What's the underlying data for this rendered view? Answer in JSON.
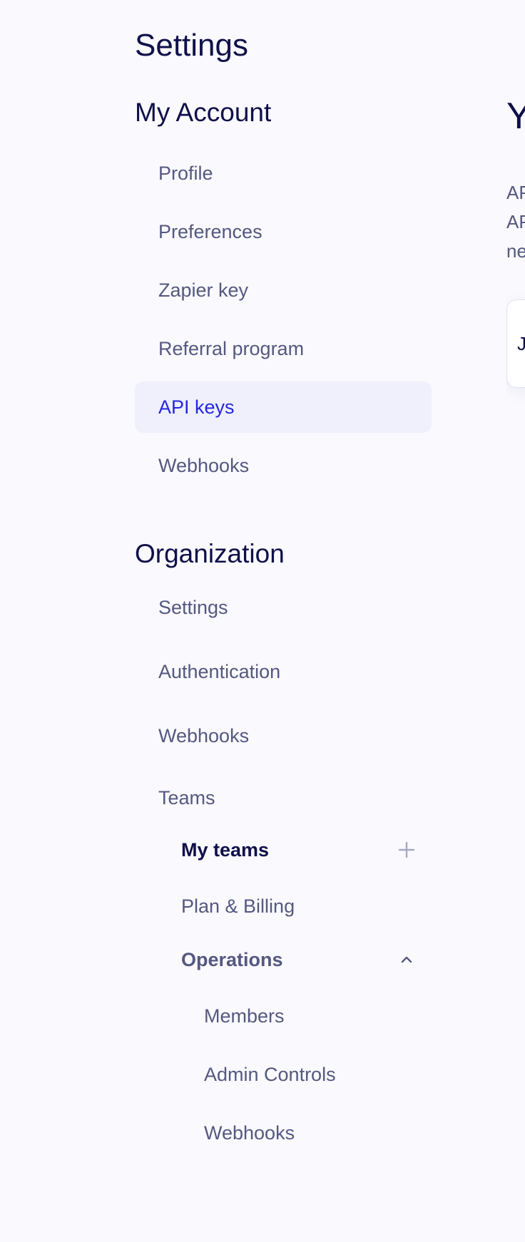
{
  "sidebar": {
    "title": "Settings",
    "my_account": {
      "heading": "My Account",
      "items": [
        {
          "label": "Profile"
        },
        {
          "label": "Preferences"
        },
        {
          "label": "Zapier key"
        },
        {
          "label": "Referral program"
        },
        {
          "label": "API keys",
          "active": true
        },
        {
          "label": "Webhooks"
        }
      ]
    },
    "organization": {
      "heading": "Organization",
      "items": [
        {
          "label": "Settings"
        },
        {
          "label": "Authentication"
        },
        {
          "label": "Webhooks"
        },
        {
          "label": "Teams"
        }
      ],
      "teams": {
        "my_teams": {
          "label": "My teams",
          "action_icon": "plus-icon"
        },
        "plan_billing": {
          "label": "Plan & Billing"
        },
        "operations": {
          "label": "Operations",
          "expanded": true,
          "toggle_icon": "chevron-up-icon",
          "items": [
            {
              "label": "Members"
            },
            {
              "label": "Admin Controls"
            },
            {
              "label": "Webhooks"
            }
          ]
        }
      }
    }
  },
  "main": {
    "heading_fragment": "Y",
    "description_fragments": [
      "AP",
      "AP",
      "ne"
    ],
    "card_fragment": "J"
  },
  "colors": {
    "background": "#f9f9fe",
    "heading": "#0f1049",
    "nav_text": "#55587f",
    "active_text": "#2626e0",
    "active_bg": "#eff0fb"
  }
}
